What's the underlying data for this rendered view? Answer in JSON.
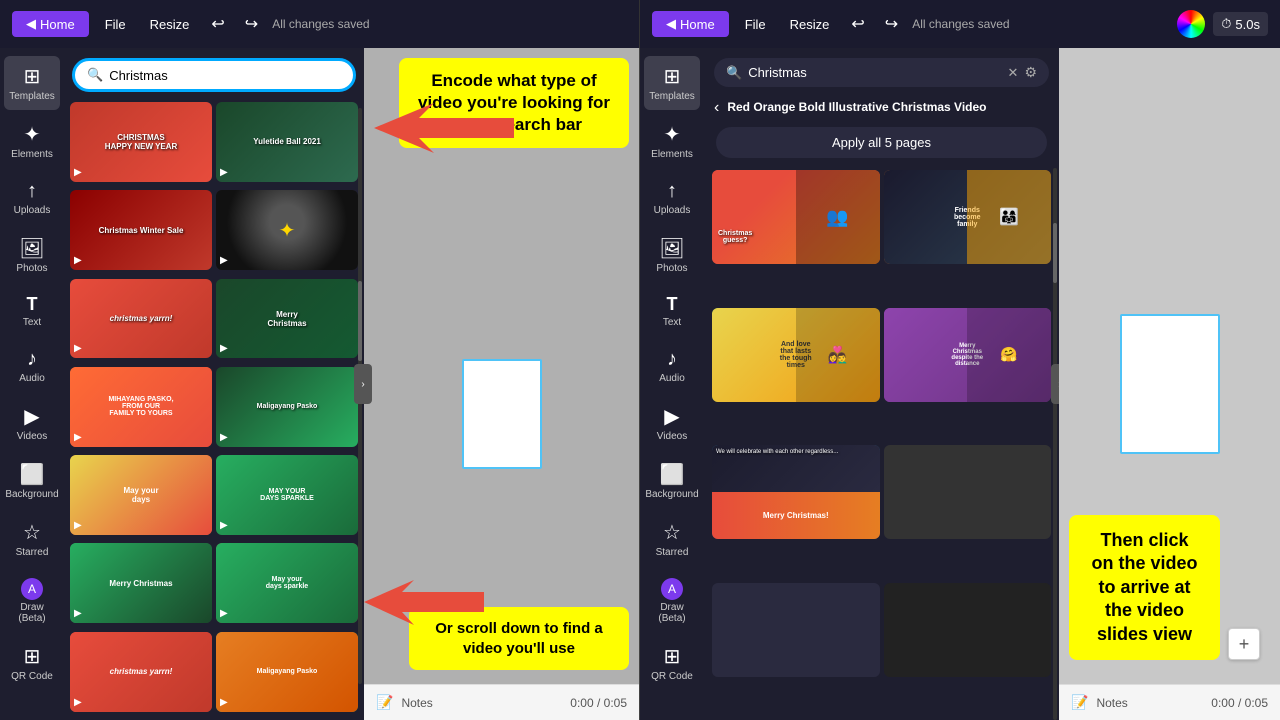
{
  "leftHeader": {
    "homeLabel": "Home",
    "fileLabel": "File",
    "resizeLabel": "Resize",
    "savedText": "All changes saved",
    "undoSymbol": "↩",
    "redoSymbol": "↪"
  },
  "rightHeader": {
    "homeLabel": "Home",
    "fileLabel": "File",
    "resizeLabel": "Resize",
    "savedText": "All changes saved",
    "undoSymbol": "↩",
    "redoSymbol": "↪",
    "timerValue": "5.0s"
  },
  "leftSidebar": {
    "items": [
      {
        "id": "templates",
        "icon": "⊞",
        "label": "Templates"
      },
      {
        "id": "elements",
        "icon": "✦",
        "label": "Elements"
      },
      {
        "id": "uploads",
        "icon": "↑",
        "label": "Uploads"
      },
      {
        "id": "photos",
        "icon": "🖼",
        "label": "Photos"
      },
      {
        "id": "text",
        "icon": "T",
        "label": "Text"
      },
      {
        "id": "audio",
        "icon": "♪",
        "label": "Audio"
      },
      {
        "id": "videos",
        "icon": "▶",
        "label": "Videos"
      },
      {
        "id": "background",
        "icon": "⬜",
        "label": "Background"
      },
      {
        "id": "starred",
        "icon": "☆",
        "label": "Starred"
      },
      {
        "id": "draw",
        "icon": "✏",
        "label": "Draw (Beta)"
      },
      {
        "id": "qrcode",
        "icon": "⊞",
        "label": "QR Code"
      }
    ]
  },
  "leftSearch": {
    "placeholder": "Christmas",
    "value": "Christmas"
  },
  "rightSidebar": {
    "items": [
      {
        "id": "templates",
        "icon": "⊞",
        "label": "Templates"
      },
      {
        "id": "elements",
        "icon": "✦",
        "label": "Elements"
      },
      {
        "id": "uploads",
        "icon": "↑",
        "label": "Uploads"
      },
      {
        "id": "photos",
        "icon": "🖼",
        "label": "Photos"
      },
      {
        "id": "text",
        "icon": "T",
        "label": "Text"
      },
      {
        "id": "audio",
        "icon": "♪",
        "label": "Audio"
      },
      {
        "id": "videos",
        "icon": "▶",
        "label": "Videos"
      },
      {
        "id": "background",
        "icon": "⬜",
        "label": "Background"
      },
      {
        "id": "starred",
        "icon": "☆",
        "label": "Starred"
      },
      {
        "id": "draw",
        "icon": "✏",
        "label": "Draw (Beta)"
      },
      {
        "id": "qrcode",
        "icon": "⊞",
        "label": "QR Code"
      }
    ]
  },
  "rightSearch": {
    "placeholder": "Christmas",
    "value": "Christmas"
  },
  "templateTitle": {
    "title": "Red Orange Bold Illustrative Christmas Video",
    "applyLabel": "Apply all 5 pages"
  },
  "annotations": {
    "searchBarNote": "Encode what type of video you're looking for in the search bar",
    "scrollNote": "Or scroll down to find a video you'll use",
    "clickNote": "Then click on the video to arrive at the video slides view"
  },
  "bottomBar": {
    "notesLabel": "Notes",
    "timeDisplay": "0:00 / 0:05"
  },
  "thumbnails": {
    "left": [
      {
        "class": "t1",
        "text": "Christmas Happy New Year"
      },
      {
        "class": "t2",
        "text": "Yuletide Ball 2021"
      },
      {
        "class": "t3",
        "text": "Christmas Winter Sale"
      },
      {
        "class": "t4",
        "text": ""
      },
      {
        "class": "t5",
        "text": "Christmas yarrn!"
      },
      {
        "class": "t6",
        "text": "Merry Christmas"
      },
      {
        "class": "t7",
        "text": "From Our Family"
      },
      {
        "class": "t8",
        "text": "Maligayang Pasko"
      },
      {
        "class": "t9",
        "text": "May your days"
      },
      {
        "class": "t10",
        "text": "May your days sparkle"
      },
      {
        "class": "t11",
        "text": "Merry Christmas"
      },
      {
        "class": "t12",
        "text": "May your days sparkle"
      },
      {
        "class": "t13",
        "text": "Christmas yarrn!"
      },
      {
        "class": "t14",
        "text": "Maligayang Pasko"
      }
    ],
    "right": [
      {
        "class": "tr1",
        "text": "Christmas Guess?"
      },
      {
        "class": "tr2",
        "text": "Friends become family"
      },
      {
        "class": "tr3",
        "text": "And love through tough"
      },
      {
        "class": "tr4",
        "text": "Merry Christmas despite"
      },
      {
        "class": "tr5",
        "text": "We will celebrate"
      },
      {
        "class": "tr6",
        "text": "Merry Christmas!"
      },
      {
        "class": "tr7",
        "text": ""
      },
      {
        "class": "tr8",
        "text": ""
      }
    ]
  }
}
